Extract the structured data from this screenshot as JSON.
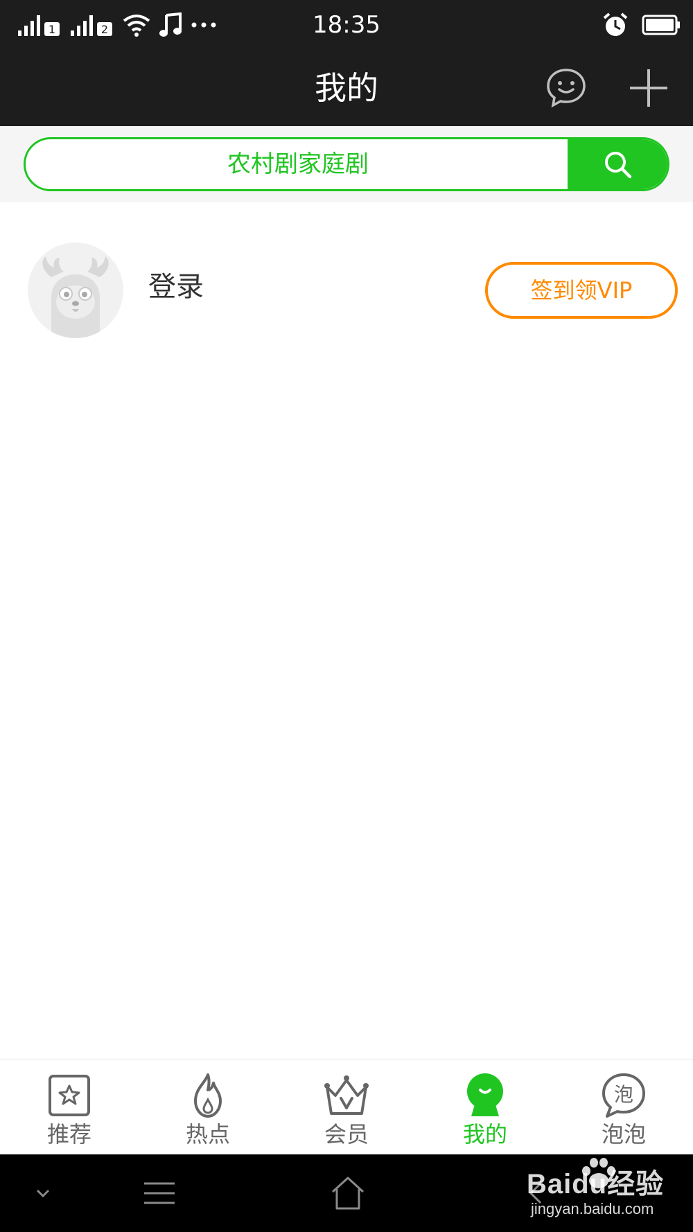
{
  "status_bar": {
    "time": "18:35",
    "sim1_label": "1",
    "sim2_label": "2",
    "icons": [
      "signal-icon",
      "signal-icon",
      "wifi-icon",
      "music-icon",
      "more-icon",
      "alarm-icon",
      "battery-icon"
    ]
  },
  "header": {
    "title": "我的",
    "icons": [
      "chat-icon",
      "plus-icon"
    ]
  },
  "search": {
    "placeholder": "农村剧家庭剧",
    "button_icon": "search-icon",
    "accent_color": "#20c521"
  },
  "profile": {
    "login_label": "登录",
    "vip_button": "签到领VIP",
    "vip_color": "#ff8a00"
  },
  "tabs": [
    {
      "label": "推荐",
      "icon": "star-icon",
      "active": false
    },
    {
      "label": "热点",
      "icon": "flame-icon",
      "active": false
    },
    {
      "label": "会员",
      "icon": "crown-icon",
      "active": false
    },
    {
      "label": "我的",
      "icon": "profile-icon",
      "active": true
    },
    {
      "label": "泡泡",
      "icon": "bubble-icon",
      "active": false
    }
  ],
  "watermark": {
    "text": "Baidu经验",
    "url": "jingyan.baidu.com"
  }
}
